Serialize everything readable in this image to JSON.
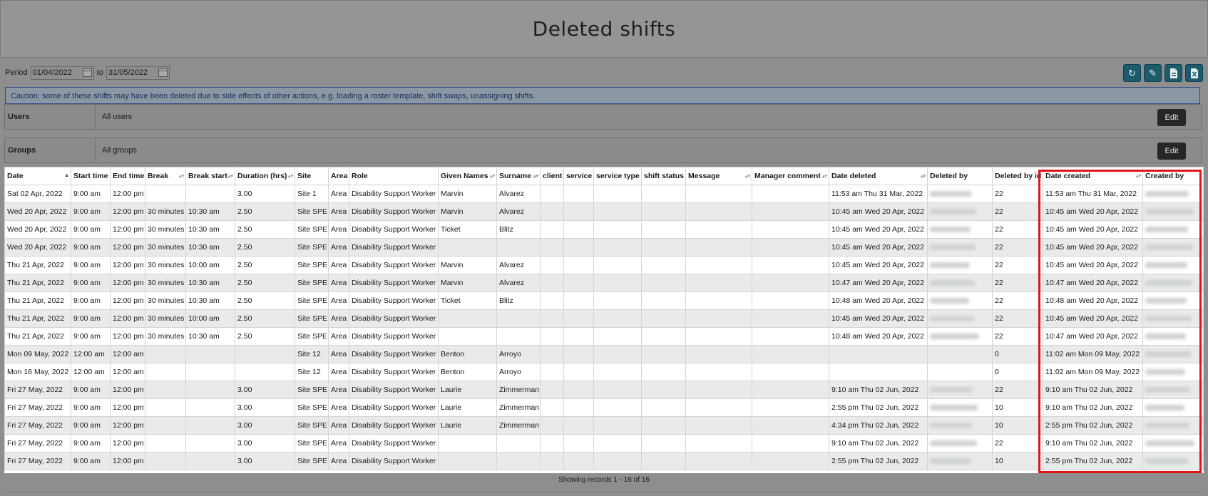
{
  "page": {
    "title": "Deleted shifts"
  },
  "period": {
    "label": "Period",
    "from": "01/04/2022",
    "to_label": "to",
    "to": "31/05/2022"
  },
  "toolbar": {
    "icons": [
      "refresh-icon",
      "edit-icon",
      "export-pdf-icon",
      "export-excel-icon"
    ]
  },
  "caution": "Caution: some of these shifts may have been deleted due to side effects of other actions, e.g. loading a roster template, shift swaps, unassigning shifts.",
  "filters": [
    {
      "label": "Users",
      "value": "All users",
      "button": "Edit"
    },
    {
      "label": "Groups",
      "value": "All groups",
      "button": "Edit"
    }
  ],
  "table": {
    "columns": [
      "Date",
      "Start time",
      "End time",
      "Break",
      "Break start",
      "Duration (hrs)",
      "Site",
      "Area",
      "Role",
      "Given Names",
      "Surname",
      "client",
      "service",
      "service type",
      "shift status",
      "Message",
      "Manager comment",
      "Date deleted",
      "Deleted by",
      "Deleted by id",
      "Date created",
      "Created by"
    ],
    "rows": [
      [
        "Sat 02 Apr, 2022",
        "9:00 am",
        "12:00 pm",
        "",
        "",
        "3.00",
        "Site 1",
        "Area",
        "Disability Support Worker",
        "Marvin",
        "Alvarez",
        "",
        "",
        "",
        "",
        "",
        "",
        "11:53 am Thu 31 Mar, 2022",
        "",
        "22",
        "11:53 am Thu 31 Mar, 2022",
        ""
      ],
      [
        "Wed 20 Apr, 2022",
        "9:00 am",
        "12:00 pm",
        "30 minutes",
        "10:30 am",
        "2.50",
        "Site SPE",
        "Area",
        "Disability Support Worker",
        "Marvin",
        "Alvarez",
        "",
        "",
        "",
        "",
        "",
        "",
        "10:45 am Wed 20 Apr, 2022",
        "",
        "22",
        "10:45 am Wed 20 Apr, 2022",
        ""
      ],
      [
        "Wed 20 Apr, 2022",
        "9:00 am",
        "12:00 pm",
        "30 minutes",
        "10:30 am",
        "2.50",
        "Site SPE",
        "Area",
        "Disability Support Worker",
        "Ticket",
        "Blitz",
        "",
        "",
        "",
        "",
        "",
        "",
        "10:45 am Wed 20 Apr, 2022",
        "",
        "22",
        "10:45 am Wed 20 Apr, 2022",
        ""
      ],
      [
        "Wed 20 Apr, 2022",
        "9:00 am",
        "12:00 pm",
        "30 minutes",
        "10:30 am",
        "2.50",
        "Site SPE",
        "Area",
        "Disability Support Worker",
        "",
        "",
        "",
        "",
        "",
        "",
        "",
        "",
        "10:45 am Wed 20 Apr, 2022",
        "",
        "22",
        "10:45 am Wed 20 Apr, 2022",
        ""
      ],
      [
        "Thu 21 Apr, 2022",
        "9:00 am",
        "12:00 pm",
        "30 minutes",
        "10:00 am",
        "2.50",
        "Site SPE",
        "Area",
        "Disability Support Worker",
        "Marvin",
        "Alvarez",
        "",
        "",
        "",
        "",
        "",
        "",
        "10:45 am Wed 20 Apr, 2022",
        "",
        "22",
        "10:45 am Wed 20 Apr, 2022",
        ""
      ],
      [
        "Thu 21 Apr, 2022",
        "9:00 am",
        "12:00 pm",
        "30 minutes",
        "10:30 am",
        "2.50",
        "Site SPE",
        "Area",
        "Disability Support Worker",
        "Marvin",
        "Alvarez",
        "",
        "",
        "",
        "",
        "",
        "",
        "10:47 am Wed 20 Apr, 2022",
        "",
        "22",
        "10:47 am Wed 20 Apr, 2022",
        ""
      ],
      [
        "Thu 21 Apr, 2022",
        "9:00 am",
        "12:00 pm",
        "30 minutes",
        "10:30 am",
        "2.50",
        "Site SPE",
        "Area",
        "Disability Support Worker",
        "Ticket",
        "Blitz",
        "",
        "",
        "",
        "",
        "",
        "",
        "10:48 am Wed 20 Apr, 2022",
        "",
        "22",
        "10:48 am Wed 20 Apr, 2022",
        ""
      ],
      [
        "Thu 21 Apr, 2022",
        "9:00 am",
        "12:00 pm",
        "30 minutes",
        "10:00 am",
        "2.50",
        "Site SPE",
        "Area",
        "Disability Support Worker",
        "",
        "",
        "",
        "",
        "",
        "",
        "",
        "",
        "10:45 am Wed 20 Apr, 2022",
        "",
        "22",
        "10:45 am Wed 20 Apr, 2022",
        ""
      ],
      [
        "Thu 21 Apr, 2022",
        "9:00 am",
        "12:00 pm",
        "30 minutes",
        "10:30 am",
        "2.50",
        "Site SPE",
        "Area",
        "Disability Support Worker",
        "",
        "",
        "",
        "",
        "",
        "",
        "",
        "",
        "10:48 am Wed 20 Apr, 2022",
        "",
        "22",
        "10:47 am Wed 20 Apr, 2022",
        ""
      ],
      [
        "Mon 09 May, 2022",
        "12:00 am",
        "12:00 am",
        "",
        "",
        "",
        "Site 12",
        "Area",
        "Disability Support Worker",
        "Benton",
        "Arroyo",
        "",
        "",
        "",
        "",
        "",
        "",
        "",
        "",
        "0",
        "11:02 am Mon 09 May, 2022",
        ""
      ],
      [
        "Mon 16 May, 2022",
        "12:00 am",
        "12:00 am",
        "",
        "",
        "",
        "Site 12",
        "Area",
        "Disability Support Worker",
        "Benton",
        "Arroyo",
        "",
        "",
        "",
        "",
        "",
        "",
        "",
        "",
        "0",
        "11:02 am Mon 09 May, 2022",
        ""
      ],
      [
        "Fri 27 May, 2022",
        "9:00 am",
        "12:00 pm",
        "",
        "",
        "3.00",
        "Site SPE",
        "Area",
        "Disability Support Worker",
        "Laurie",
        "Zimmerman",
        "",
        "",
        "",
        "",
        "",
        "",
        "9:10 am Thu 02 Jun, 2022",
        "",
        "22",
        "9:10 am Thu 02 Jun, 2022",
        ""
      ],
      [
        "Fri 27 May, 2022",
        "9:00 am",
        "12:00 pm",
        "",
        "",
        "3.00",
        "Site SPE",
        "Area",
        "Disability Support Worker",
        "Laurie",
        "Zimmerman",
        "",
        "",
        "",
        "",
        "",
        "",
        "2:55 pm Thu 02 Jun, 2022",
        "",
        "10",
        "9:10 am Thu 02 Jun, 2022",
        ""
      ],
      [
        "Fri 27 May, 2022",
        "9:00 am",
        "12:00 pm",
        "",
        "",
        "3.00",
        "Site SPE",
        "Area",
        "Disability Support Worker",
        "Laurie",
        "Zimmerman",
        "",
        "",
        "",
        "",
        "",
        "",
        "4:34 pm Thu 02 Jun, 2022",
        "",
        "10",
        "2:55 pm Thu 02 Jun, 2022",
        ""
      ],
      [
        "Fri 27 May, 2022",
        "9:00 am",
        "12:00 pm",
        "",
        "",
        "3.00",
        "Site SPE",
        "Area",
        "Disability Support Worker",
        "",
        "",
        "",
        "",
        "",
        "",
        "",
        "",
        "9:10 am Thu 02 Jun, 2022",
        "",
        "22",
        "9:10 am Thu 02 Jun, 2022",
        ""
      ],
      [
        "Fri 27 May, 2022",
        "9:00 am",
        "12:00 pm",
        "",
        "",
        "3.00",
        "Site SPE",
        "Area",
        "Disability Support Worker",
        "",
        "",
        "",
        "",
        "",
        "",
        "",
        "",
        "2:55 pm Thu 02 Jun, 2022",
        "",
        "10",
        "2:55 pm Thu 02 Jun, 2022",
        ""
      ]
    ]
  },
  "footer": "Showing records 1 - 16 of 16"
}
